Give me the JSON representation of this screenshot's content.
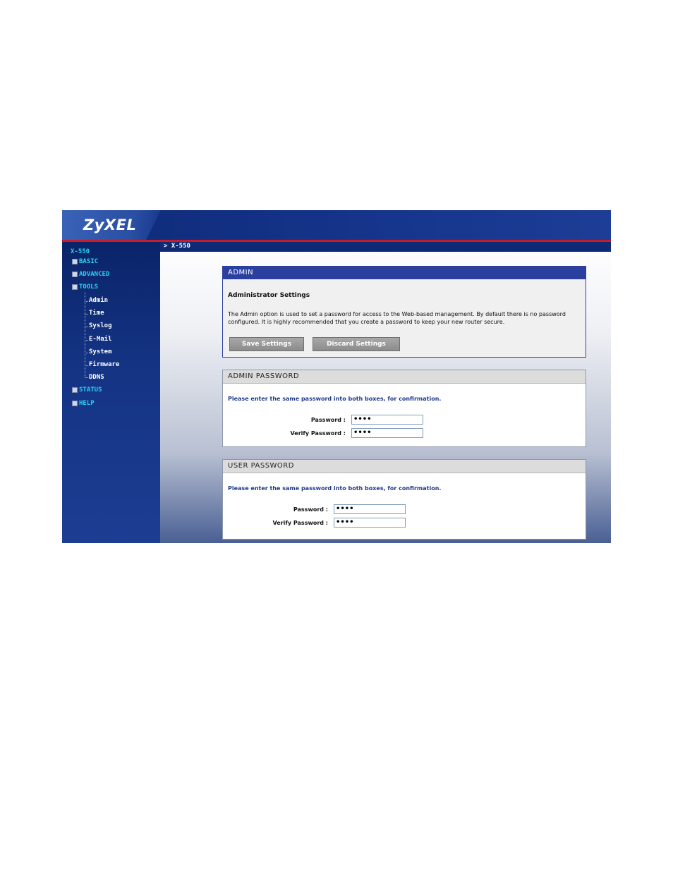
{
  "header": {
    "logo": "ZyXEL"
  },
  "breadcrumb": "> X-550",
  "sidebar": {
    "title": "X-550",
    "items": [
      {
        "label": "BASIC"
      },
      {
        "label": "ADVANCED"
      },
      {
        "label": "TOOLS"
      },
      {
        "label": "STATUS"
      },
      {
        "label": "HELP"
      }
    ],
    "tools_sub": [
      "Admin",
      "Time",
      "Syslog",
      "E-Mail",
      "System",
      "Firmware",
      "DDNS"
    ]
  },
  "admin_panel": {
    "title": "ADMIN",
    "heading": "Administrator Settings",
    "description_line1": "The Admin option is used to set a password for access to the Web-based management. By default there is no password",
    "description_line2": "configured. It is highly recommended that you create a password to keep your new router secure.",
    "save_label": "Save Settings",
    "discard_label": "Discard Settings"
  },
  "admin_password": {
    "title": "ADMIN PASSWORD",
    "note": "Please enter the same password into both boxes, for confirmation.",
    "password_label": "Password :",
    "verify_label": "Verify Password :",
    "password_value": "••••",
    "verify_value": "••••"
  },
  "user_password": {
    "title": "USER PASSWORD",
    "note": "Please enter the same password into both boxes, for confirmation.",
    "password_label": "Password :",
    "verify_label": "Verify Password :",
    "password_value": "••••",
    "verify_value": "••••"
  },
  "colors": {
    "header_blue": "#0e2a78",
    "red_stripe": "#c81b2b",
    "nav_cyan": "#2bd1f5",
    "panel_head_blue": "#2a3f9e"
  }
}
